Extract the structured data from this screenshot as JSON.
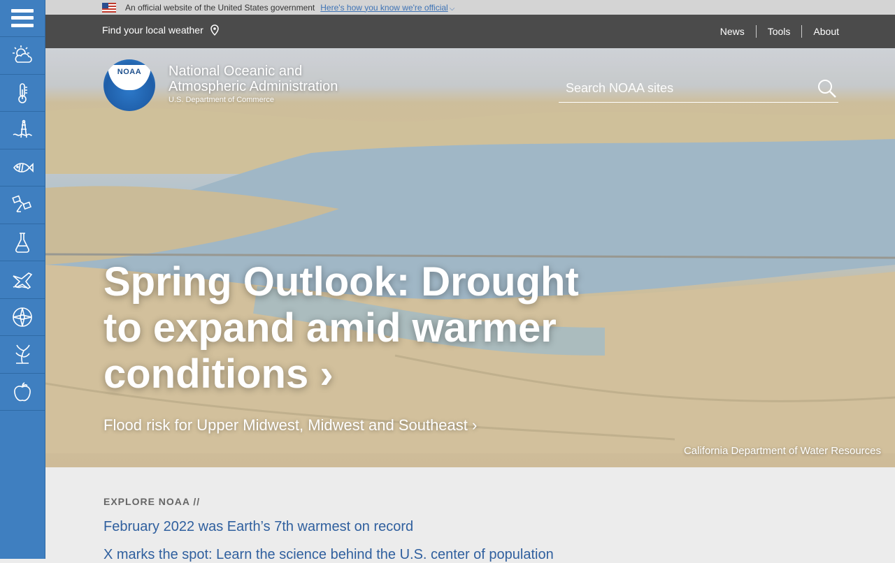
{
  "gov_banner": {
    "text": "An official website of the United States government",
    "link": "Here's how you know we're official"
  },
  "topnav": {
    "find_weather": "Find your local weather",
    "links": [
      "News",
      "Tools",
      "About"
    ]
  },
  "sidebar": {
    "icons": [
      "weather-icon",
      "climate-icon",
      "ocean-coasts-icon",
      "fisheries-icon",
      "satellites-icon",
      "research-icon",
      "marine-aviation-icon",
      "charting-icon",
      "sanctuaries-icon",
      "education-icon"
    ]
  },
  "org": {
    "logo_text": "NOAA",
    "name_line1": "National Oceanic and",
    "name_line2": "Atmospheric Administration",
    "dept": "U.S. Department of Commerce"
  },
  "search": {
    "placeholder": "Search NOAA sites"
  },
  "hero": {
    "headline": "Spring Outlook: Drought to expand amid warmer conditions",
    "subhead": "Flood risk for Upper Midwest, Midwest and Southeast",
    "credit": "California Department of Water Resources"
  },
  "explore": {
    "title": "EXPLORE NOAA //",
    "items": [
      "February 2022 was Earth’s 7th warmest on record",
      "X marks the spot: Learn the science behind the U.S. center of population"
    ]
  },
  "colors": {
    "sidebar": "#3f7fc0",
    "topnav": "#4b4b4b",
    "link": "#2f5f9e"
  }
}
